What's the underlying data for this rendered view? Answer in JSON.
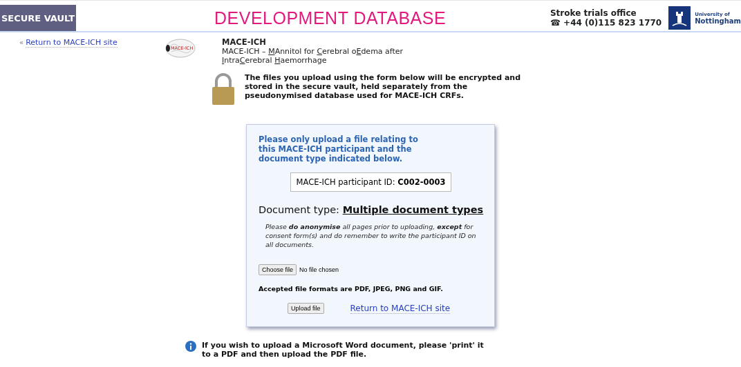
{
  "header": {
    "badge": "SECURE VAULT",
    "title": "DEVELOPMENT DATABASE",
    "office": "Stroke trials office",
    "phone_icon": "☎",
    "phone": "+44 (0)115 823 1770",
    "university_line1": "University of",
    "university_line2": "Nottingham"
  },
  "back_link": {
    "arrow": "«",
    "label": "Return to MACE-ICH site"
  },
  "study": {
    "logo_text": "MACE-ICH",
    "name": "MACE-ICH",
    "description": [
      {
        "text": "MACE-ICH – ",
        "underlined": false
      },
      {
        "text": "M",
        "underlined": true
      },
      {
        "text": "Annitol for ",
        "underlined": false
      },
      {
        "text": "C",
        "underlined": true
      },
      {
        "text": "erebral o",
        "underlined": false
      },
      {
        "text": "E",
        "underlined": true
      },
      {
        "text": "dema after ",
        "underlined": false
      },
      {
        "text": "I",
        "underlined": true
      },
      {
        "text": "ntra",
        "underlined": false
      },
      {
        "text": "C",
        "underlined": true
      },
      {
        "text": "erebral ",
        "underlined": false
      },
      {
        "text": "H",
        "underlined": true
      },
      {
        "text": "aemorrhage",
        "underlined": false
      }
    ]
  },
  "notice": "The files you upload using the form below will be encrypted and stored in the secure vault, held separately from the pseudonymised database used for MACE-ICH CRFs.",
  "form": {
    "intro": "Please only upload a file relating to this MACE-ICH participant and the document type indicated below.",
    "participant_label": "MACE-ICH participant ID: ",
    "participant_id": "C002-0003",
    "doctype_label": "Document type: ",
    "doctype": "Multiple document types",
    "instructions": "Please **do anonymise** all pages prior to uploading, **except** for consent form(s) and do remember to write the participant ID on all documents.",
    "choose_button": "Choose file",
    "file_status": "No file chosen",
    "formats": "Accepted file formats are PDF, JPEG, PNG and GIF.",
    "upload_button": "Upload file",
    "return_link": "Return to MACE-ICH site"
  },
  "footer_note": "If you wish to upload a Microsoft Word document, please 'print' it to a PDF and then upload the PDF file."
}
